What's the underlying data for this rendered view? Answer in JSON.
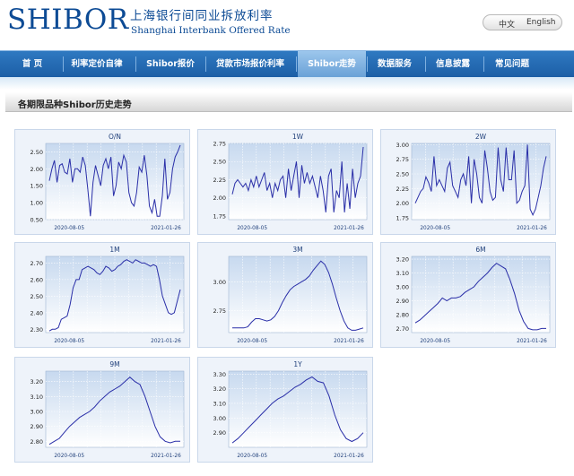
{
  "header": {
    "logo": "SHIBOR",
    "cn_name": "上海银行间同业拆放利率",
    "en_name": "Shanghai Interbank Offered Rate",
    "lang_zh": "中文",
    "lang_en": "English"
  },
  "nav": {
    "items": [
      "首 页",
      "利率定价自律",
      "Shibor报价",
      "贷款市场报价利率",
      "Shibor走势",
      "数据服务",
      "信息披露",
      "常见问题"
    ],
    "active": "Shibor走势"
  },
  "section": {
    "title": "各期限品种Shibor历史走势"
  },
  "chart_data": [
    {
      "type": "line",
      "title": "O/N",
      "x_tick_labels": [
        "2020-08-05",
        "2021-01-26"
      ],
      "ylim": [
        0.5,
        2.75
      ],
      "yticks": [
        0.5,
        1.0,
        1.5,
        2.0,
        2.5
      ],
      "y_tick_labels": [
        "0.50",
        "1.00",
        "1.50",
        "2.00",
        "2.50"
      ],
      "grid": true,
      "values": [
        1.65,
        2.0,
        2.25,
        1.6,
        2.1,
        2.15,
        1.9,
        1.85,
        2.3,
        1.6,
        2.0,
        2.0,
        1.9,
        2.35,
        2.1,
        1.4,
        0.6,
        1.6,
        2.1,
        1.8,
        1.5,
        2.1,
        2.3,
        2.0,
        2.35,
        1.2,
        1.5,
        2.2,
        2.0,
        2.4,
        2.2,
        1.3,
        1.0,
        0.9,
        1.3,
        2.05,
        1.9,
        2.4,
        1.8,
        0.9,
        0.7,
        1.1,
        0.6,
        0.6,
        1.2,
        2.3,
        1.1,
        1.3,
        2.0,
        2.35,
        2.5,
        2.7
      ]
    },
    {
      "type": "line",
      "title": "1W",
      "x_tick_labels": [
        "2020-08-05",
        "2021-01-26"
      ],
      "ylim": [
        1.7,
        2.75
      ],
      "yticks": [
        1.75,
        2.0,
        2.25,
        2.5,
        2.75
      ],
      "y_tick_labels": [
        "1.75",
        "2.00",
        "2.25",
        "2.50",
        "2.75"
      ],
      "grid": true,
      "values": [
        2.05,
        2.2,
        2.25,
        2.2,
        2.15,
        2.2,
        2.1,
        2.25,
        2.15,
        2.3,
        2.15,
        2.25,
        2.35,
        2.1,
        2.2,
        2.0,
        2.2,
        2.1,
        2.25,
        2.3,
        2.0,
        2.4,
        2.1,
        2.3,
        2.5,
        2.0,
        2.45,
        2.2,
        2.35,
        2.2,
        2.3,
        2.15,
        2.0,
        2.3,
        2.1,
        1.8,
        2.3,
        2.4,
        1.8,
        2.1,
        2.0,
        2.5,
        1.8,
        2.2,
        1.85,
        2.4,
        2.0,
        2.2,
        2.3,
        2.7
      ]
    },
    {
      "type": "line",
      "title": "2W",
      "x_tick_labels": [
        "2020-08-05",
        "2021-01-26"
      ],
      "ylim": [
        1.72,
        3.02
      ],
      "yticks": [
        1.75,
        2.0,
        2.25,
        2.5,
        2.75,
        3.0
      ],
      "y_tick_labels": [
        "1.75",
        "2.00",
        "2.25",
        "2.50",
        "2.75",
        "3.00"
      ],
      "grid": true,
      "values": [
        2.0,
        2.1,
        2.2,
        2.25,
        2.45,
        2.35,
        2.2,
        2.8,
        2.3,
        2.4,
        2.3,
        2.2,
        2.6,
        2.7,
        2.3,
        2.2,
        2.1,
        2.4,
        2.5,
        2.3,
        2.8,
        2.0,
        2.75,
        2.5,
        2.1,
        2.0,
        2.9,
        2.6,
        2.2,
        2.05,
        2.1,
        2.95,
        2.4,
        2.2,
        2.95,
        2.4,
        2.4,
        2.9,
        2.0,
        2.05,
        2.2,
        2.3,
        3.0,
        1.9,
        1.8,
        1.9,
        2.1,
        2.3,
        2.6,
        2.8
      ]
    },
    {
      "type": "line",
      "title": "1M",
      "x_tick_labels": [
        "2020-08-05",
        "2021-01-26"
      ],
      "ylim": [
        2.28,
        2.74
      ],
      "yticks": [
        2.3,
        2.4,
        2.5,
        2.6,
        2.7
      ],
      "y_tick_labels": [
        "2.30",
        "2.40",
        "2.50",
        "2.60",
        "2.70"
      ],
      "grid": true,
      "values": [
        2.29,
        2.3,
        2.3,
        2.31,
        2.36,
        2.37,
        2.38,
        2.45,
        2.55,
        2.6,
        2.6,
        2.66,
        2.67,
        2.68,
        2.67,
        2.66,
        2.64,
        2.63,
        2.65,
        2.68,
        2.67,
        2.65,
        2.66,
        2.68,
        2.69,
        2.71,
        2.72,
        2.71,
        2.7,
        2.72,
        2.71,
        2.7,
        2.7,
        2.69,
        2.68,
        2.69,
        2.68,
        2.6,
        2.5,
        2.45,
        2.4,
        2.39,
        2.4,
        2.47,
        2.54
      ]
    },
    {
      "type": "line",
      "title": "3M",
      "x_tick_labels": [
        "2020-08-05",
        "2021-01-26"
      ],
      "ylim": [
        2.56,
        3.22
      ],
      "yticks": [
        2.75,
        3.0
      ],
      "y_tick_labels": [
        "2.75",
        "3.00"
      ],
      "grid": true,
      "values": [
        2.6,
        2.6,
        2.6,
        2.6,
        2.61,
        2.65,
        2.68,
        2.68,
        2.67,
        2.66,
        2.67,
        2.7,
        2.75,
        2.82,
        2.88,
        2.93,
        2.96,
        2.98,
        3.0,
        3.02,
        3.05,
        3.1,
        3.14,
        3.18,
        3.15,
        3.08,
        2.98,
        2.86,
        2.75,
        2.66,
        2.6,
        2.58,
        2.58,
        2.59,
        2.6
      ]
    },
    {
      "type": "line",
      "title": "6M",
      "x_tick_labels": [
        "2020-08-05",
        "2021-01-26"
      ],
      "ylim": [
        2.67,
        3.22
      ],
      "yticks": [
        2.7,
        2.8,
        2.9,
        3.0,
        3.1,
        3.2
      ],
      "y_tick_labels": [
        "2.70",
        "2.80",
        "2.90",
        "3.00",
        "3.10",
        "3.20"
      ],
      "grid": true,
      "values": [
        2.74,
        2.76,
        2.79,
        2.82,
        2.85,
        2.88,
        2.92,
        2.9,
        2.92,
        2.92,
        2.93,
        2.96,
        2.98,
        3.0,
        3.04,
        3.07,
        3.1,
        3.14,
        3.17,
        3.15,
        3.13,
        3.05,
        2.95,
        2.83,
        2.75,
        2.7,
        2.69,
        2.69,
        2.7,
        2.7
      ]
    },
    {
      "type": "line",
      "title": "9M",
      "x_tick_labels": [
        "2020-08-05",
        "2021-01-26"
      ],
      "ylim": [
        2.76,
        3.27
      ],
      "yticks": [
        2.8,
        2.9,
        3.0,
        3.1,
        3.2
      ],
      "y_tick_labels": [
        "2.80",
        "2.90",
        "3.00",
        "3.10",
        "3.20"
      ],
      "grid": true,
      "values": [
        2.78,
        2.8,
        2.82,
        2.86,
        2.9,
        2.93,
        2.96,
        2.98,
        3.0,
        3.03,
        3.07,
        3.1,
        3.13,
        3.15,
        3.17,
        3.2,
        3.23,
        3.2,
        3.18,
        3.1,
        3.0,
        2.9,
        2.83,
        2.8,
        2.79,
        2.8,
        2.8
      ]
    },
    {
      "type": "line",
      "title": "1Y",
      "x_tick_labels": [
        "2020-08-05",
        "2021-01-26"
      ],
      "ylim": [
        2.8,
        3.32
      ],
      "yticks": [
        2.9,
        3.0,
        3.1,
        3.2,
        3.3
      ],
      "y_tick_labels": [
        "2.90",
        "3.00",
        "3.10",
        "3.20",
        "3.30"
      ],
      "grid": true,
      "values": [
        2.83,
        2.86,
        2.9,
        2.94,
        2.98,
        3.02,
        3.06,
        3.1,
        3.13,
        3.15,
        3.18,
        3.21,
        3.23,
        3.26,
        3.28,
        3.25,
        3.24,
        3.15,
        3.02,
        2.92,
        2.86,
        2.84,
        2.86,
        2.9
      ]
    }
  ]
}
